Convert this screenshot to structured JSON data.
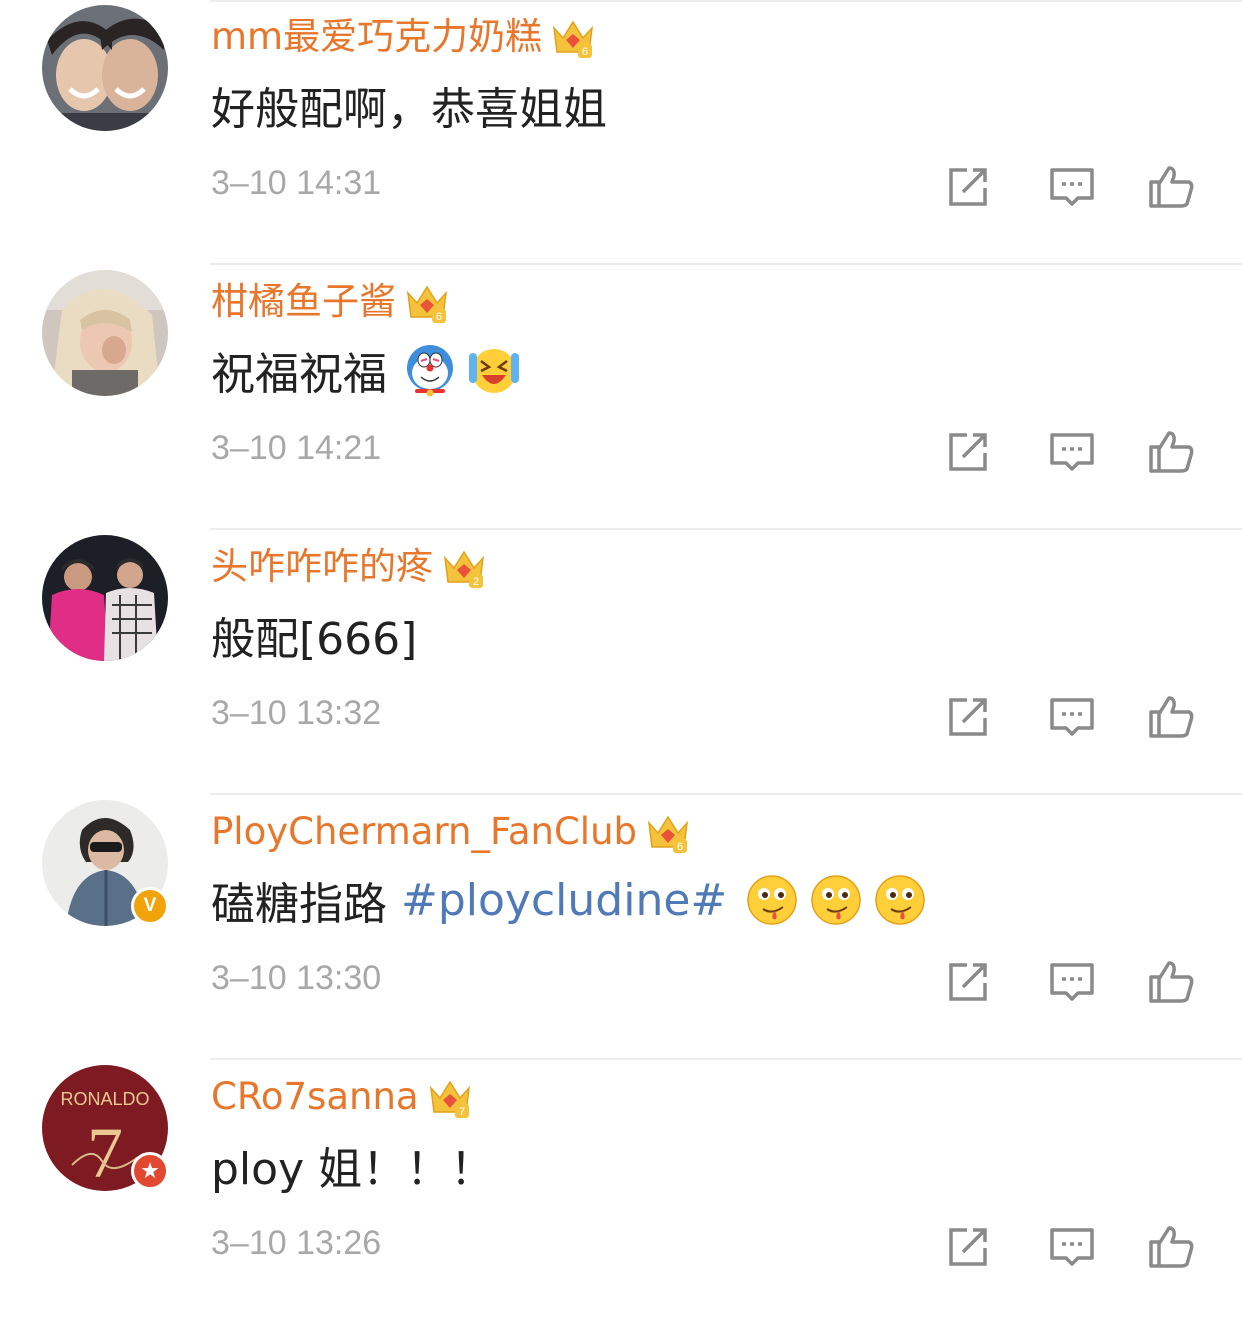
{
  "accent_colors": {
    "username": "#e8762b",
    "hashtag": "#4f7ab7",
    "time": "#a8a8a8"
  },
  "comments": [
    {
      "username": "mm最爱巧克力奶糕",
      "level": "6",
      "text": "好般配啊，恭喜姐姐",
      "time": "3–10 14:31"
    },
    {
      "username": "柑橘鱼子酱",
      "level": "6",
      "text": "祝福祝福",
      "emojis": [
        "doraemon-emoji",
        "laughing-cry-emoji"
      ],
      "time": "3–10 14:21"
    },
    {
      "username": "头咋咋咋的疼",
      "level": "2",
      "text": "般配[666]",
      "time": "3–10 13:32"
    },
    {
      "username": "PloyChermarn_FanClub",
      "level": "6",
      "text": "磕糖指路",
      "hashtag": "#ploycludine#",
      "emojis": [
        "drool-emoji",
        "drool-emoji",
        "drool-emoji"
      ],
      "badge": "V",
      "time": "3–10 13:30"
    },
    {
      "username": "CRo7sanna",
      "level": "7",
      "text": "ploy 姐！！！",
      "badge": "★",
      "avatar_text": "RONALDO",
      "avatar_number": "7",
      "time": "3–10 13:26"
    }
  ],
  "icons": {
    "share": "share-icon",
    "reply": "comment-icon",
    "like": "thumbs-up-icon",
    "crown": "crown-level-icon"
  }
}
